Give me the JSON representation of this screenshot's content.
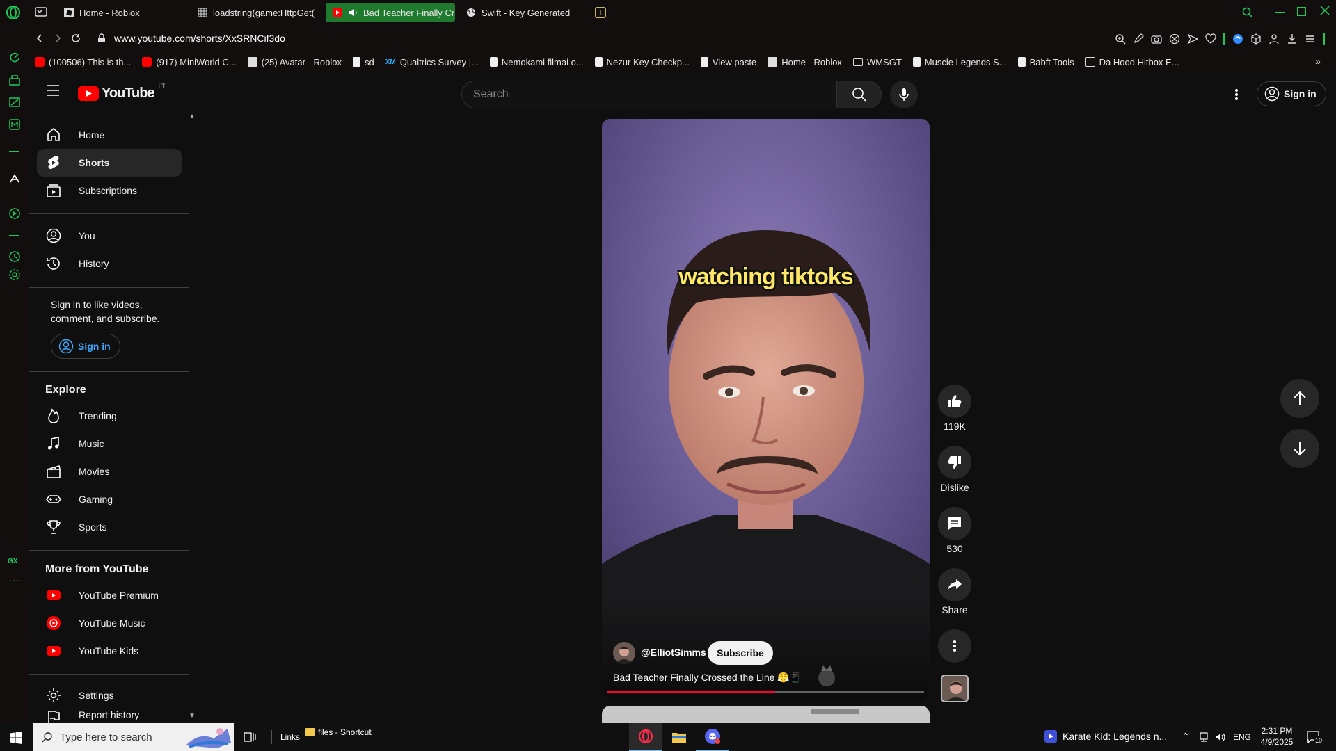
{
  "browser": {
    "tabs": [
      {
        "label": "Home - Roblox",
        "icon": "roblox-icon"
      },
      {
        "label": "loadstring(game:HttpGet(",
        "icon": "grid-icon"
      },
      {
        "label": "Bad Teacher Finally Cr",
        "icon": "youtube-icon"
      },
      {
        "label": "Swift - Key Generated",
        "icon": "globe-icon"
      }
    ],
    "url": "www.youtube.com/shorts/XxSRNCif3do",
    "bookmarks": [
      "(100506) This is th...",
      "(917) MiniWorld C...",
      "(25) Avatar - Roblox",
      "sd",
      "Qualtrics Survey |...",
      "Nemokami filmai o...",
      "Nezur Key Checkp...",
      "View paste",
      "Home - Roblox",
      "WMSGT",
      "Muscle Legends S...",
      "Babft Tools",
      "Da Hood Hitbox E..."
    ],
    "bookmark_badge": "XM",
    "gx_label": "GX"
  },
  "youtube": {
    "logo_text": "YouTube",
    "country": "LT",
    "search_placeholder": "Search",
    "sign_in": "Sign in",
    "sidebar": {
      "main": [
        {
          "label": "Home",
          "icon": "home-icon"
        },
        {
          "label": "Shorts",
          "icon": "shorts-icon"
        },
        {
          "label": "Subscriptions",
          "icon": "subscriptions-icon"
        }
      ],
      "you": [
        {
          "label": "You",
          "icon": "account-icon"
        },
        {
          "label": "History",
          "icon": "history-icon"
        }
      ],
      "signin_prompt": "Sign in to like videos, comment, and subscribe.",
      "signin_button": "Sign in",
      "explore_title": "Explore",
      "explore": [
        {
          "label": "Trending",
          "icon": "trending-icon"
        },
        {
          "label": "Music",
          "icon": "music-icon"
        },
        {
          "label": "Movies",
          "icon": "movies-icon"
        },
        {
          "label": "Gaming",
          "icon": "gaming-icon"
        },
        {
          "label": "Sports",
          "icon": "trophy-icon"
        }
      ],
      "more_title": "More from YouTube",
      "more": [
        {
          "label": "YouTube Premium",
          "icon": "youtube-premium-icon"
        },
        {
          "label": "YouTube Music",
          "icon": "youtube-music-icon"
        },
        {
          "label": "YouTube Kids",
          "icon": "youtube-kids-icon"
        }
      ],
      "settings": "Settings",
      "report": "Report history"
    },
    "short": {
      "caption_overlay": "watching tiktoks",
      "channel": "@ElliotSimms",
      "subscribe": "Subscribe",
      "title": "Bad Teacher Finally Crossed the Line 😤📱",
      "progress": 0.53,
      "likes": "119K",
      "dislike_label": "Dislike",
      "comments": "530",
      "share_label": "Share"
    }
  },
  "taskbar": {
    "search_placeholder": "Type here to search",
    "links_label": "Links",
    "files_label": "files - Shortcut",
    "media_title": "Karate Kid: Legends n...",
    "lang": "ENG",
    "time": "2:31 PM",
    "date": "4/9/2025",
    "notif_count": "10"
  },
  "colors": {
    "accent_green": "#1f7a2e",
    "opera_green": "#1ec95a",
    "youtube_red": "#ff0000",
    "link_blue": "#3ea6ff"
  }
}
